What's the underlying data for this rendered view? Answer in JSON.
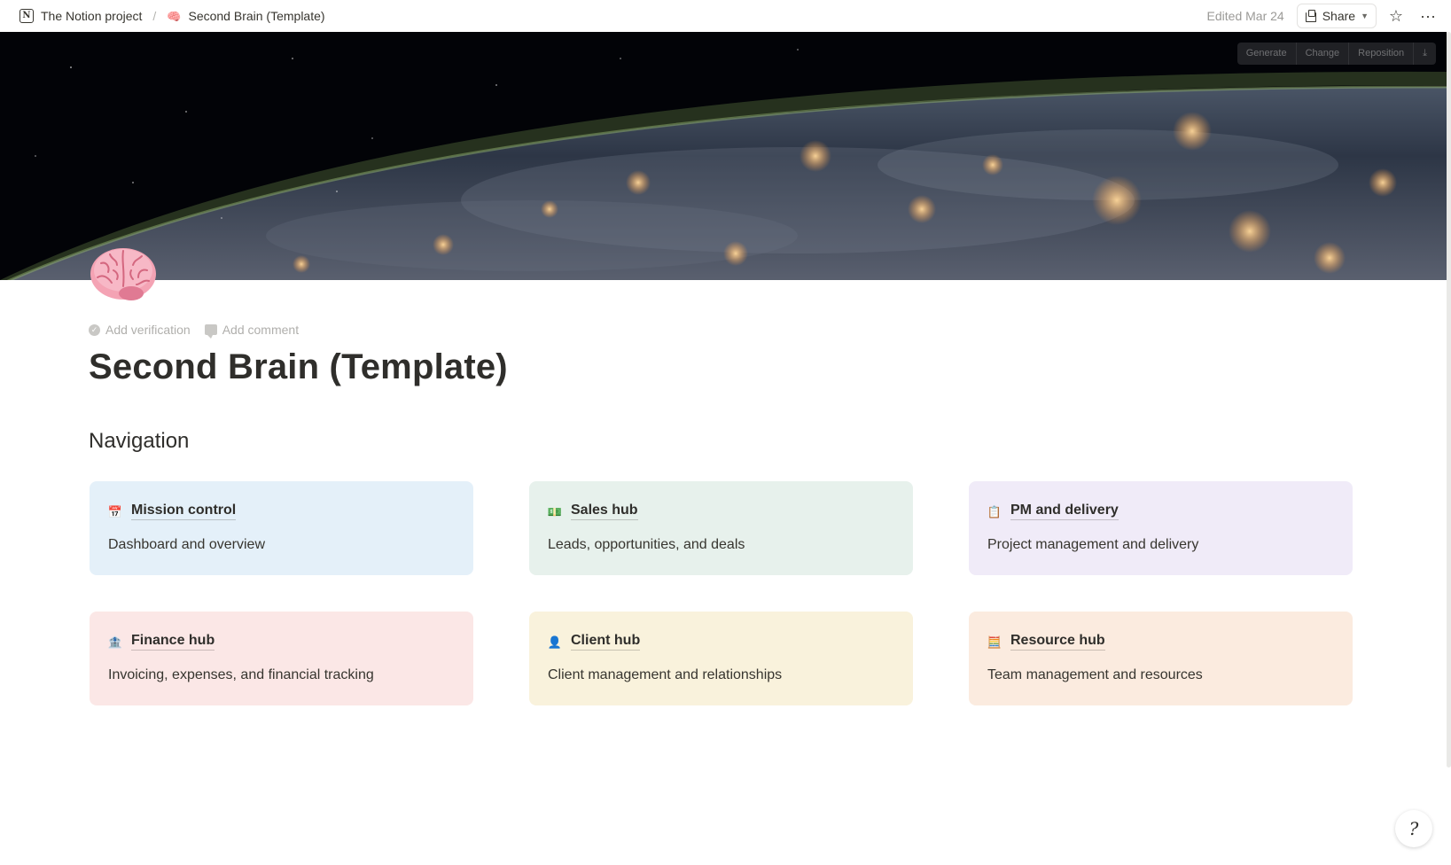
{
  "topbar": {
    "workspace": "The Notion project",
    "workspace_logo": "N",
    "separator": "/",
    "page_emoji": "🧠",
    "page_name": "Second Brain (Template)",
    "edited": "Edited Mar 24",
    "share_label": "Share",
    "favorite_icon": "☆",
    "more_icon": "···"
  },
  "cover": {
    "controls": [
      "Generate",
      "Change",
      "Reposition",
      "⤓"
    ]
  },
  "page": {
    "add_verification": "Add verification",
    "add_comment": "Add comment",
    "title": "Second Brain (Template)",
    "section_heading": "Navigation"
  },
  "cards": [
    {
      "emoji": "📅",
      "title": "Mission control",
      "desc": "Dashboard and overview",
      "bg": "#e4f0f9"
    },
    {
      "emoji": "💵",
      "title": "Sales hub",
      "desc": "Leads, opportunities, and deals",
      "bg": "#e7f1ec"
    },
    {
      "emoji": "📋",
      "title": "PM and delivery",
      "desc": "Project management and delivery",
      "bg": "#f0ebf8"
    },
    {
      "emoji": "🏦",
      "title": "Finance hub",
      "desc": "Invoicing, expenses, and financial tracking",
      "bg": "#fbe7e6"
    },
    {
      "emoji": "👤",
      "title": "Client hub",
      "desc": "Client management and relationships",
      "bg": "#f9f2dc"
    },
    {
      "emoji": "🧮",
      "title": "Resource hub",
      "desc": "Team management and resources",
      "bg": "#fbebdf"
    }
  ],
  "help": {
    "label": "?"
  }
}
